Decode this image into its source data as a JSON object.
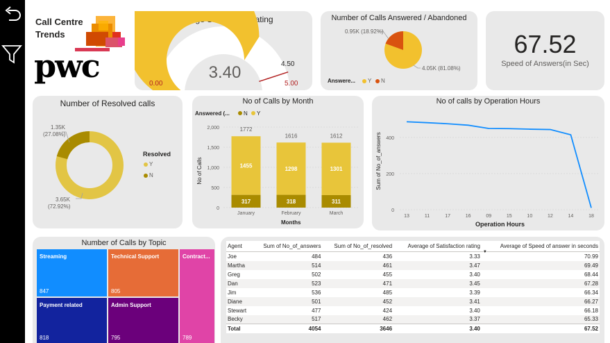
{
  "header": {
    "title_line1": "Call Centre",
    "title_line2": "Trends",
    "logo_text": "pwc"
  },
  "gauge": {
    "title": "Average Satisfaction rating",
    "value": "3.40",
    "min": "0.00",
    "max": "5.00",
    "target": "4.50",
    "numeric_value": 3.4,
    "numeric_max": 5.0,
    "numeric_target": 4.5,
    "fill_color": "#f2c12e",
    "track_color": "#ffffff",
    "target_color": "#b22222"
  },
  "answered_pie": {
    "title": "Number of Calls Answered / Abandoned",
    "legend_label": "Answere...",
    "legend_y": "Y",
    "legend_n": "N",
    "label_n": "0.95K (18.92%)",
    "label_y": "4.05K (81.08%)"
  },
  "kpi": {
    "value": "67.52",
    "label": "Speed of Answers(in Sec)"
  },
  "resolved_donut": {
    "title": "Number of Resolved calls",
    "legend_title": "Resolved",
    "legend_y": "Y",
    "legend_n": "N",
    "label_n_line1": "1.35K",
    "label_n_line2": "(27.08%)",
    "label_y_line1": "3.65K",
    "label_y_line2": "(72.92%)"
  },
  "month_chart": {
    "title": "No of Calls by Month",
    "legend_label": "Answered (...",
    "legend_n": "N",
    "legend_y": "Y",
    "ylabel": "No of Calls",
    "xlabel": "Months",
    "yticks": [
      "2,000",
      "1,500",
      "1,000",
      "500",
      "0"
    ]
  },
  "hours_chart": {
    "title": "No of calls by Operation Hours",
    "ylabel": "Sum of No_of_answers",
    "xlabel": "Operation Hours",
    "yticks": [
      "400",
      "200",
      "0"
    ]
  },
  "topic_tree": {
    "title": "Number of Calls by Topic",
    "cells": [
      {
        "label": "Streaming",
        "value": "847",
        "color": "#118dff"
      },
      {
        "label": "Technical Support",
        "value": "805",
        "color": "#e66c37"
      },
      {
        "label": "Contract...",
        "value": "789",
        "color": "#e044a7"
      },
      {
        "label": "Payment related",
        "value": "818",
        "color": "#12239e"
      },
      {
        "label": "Admin Support",
        "value": "795",
        "color": "#6b007b"
      }
    ]
  },
  "agent_table": {
    "headers": [
      "Agent",
      "Sum of No_of_answers",
      "Sum of No_of_resolved",
      "Average of Satisfaction rating",
      "Average of Speed of answer in seconds"
    ],
    "rows": [
      [
        "Joe",
        "484",
        "436",
        "3.33",
        "70.99"
      ],
      [
        "Martha",
        "514",
        "461",
        "3.47",
        "69.49"
      ],
      [
        "Greg",
        "502",
        "455",
        "3.40",
        "68.44"
      ],
      [
        "Dan",
        "523",
        "471",
        "3.45",
        "67.28"
      ],
      [
        "Jim",
        "536",
        "485",
        "3.39",
        "66.34"
      ],
      [
        "Diane",
        "501",
        "452",
        "3.41",
        "66.27"
      ],
      [
        "Stewart",
        "477",
        "424",
        "3.40",
        "66.18"
      ],
      [
        "Becky",
        "517",
        "462",
        "3.37",
        "65.33"
      ]
    ],
    "total": [
      "Total",
      "4054",
      "3646",
      "3.40",
      "67.52"
    ]
  },
  "chart_data": [
    {
      "type": "bar",
      "title": "No of Calls by Month",
      "xlabel": "Months",
      "ylabel": "No of Calls",
      "categories": [
        "January",
        "February",
        "March"
      ],
      "series": [
        {
          "name": "N",
          "values": [
            317,
            318,
            311
          ],
          "color": "#a98b00"
        },
        {
          "name": "Y",
          "values": [
            1455,
            1298,
            1301
          ],
          "color": "#e8c53a"
        }
      ],
      "totals": [
        1772,
        1616,
        1612
      ],
      "ylim": [
        0,
        2000
      ]
    },
    {
      "type": "line",
      "title": "No of calls by Operation Hours",
      "xlabel": "Operation Hours",
      "ylabel": "Sum of No_of_answers",
      "categories": [
        "13",
        "11",
        "17",
        "16",
        "09",
        "15",
        "10",
        "12",
        "14",
        "18"
      ],
      "values": [
        487,
        482,
        476,
        468,
        450,
        449,
        446,
        444,
        415,
        10
      ],
      "ylim": [
        0,
        500
      ],
      "color": "#118dff"
    },
    {
      "type": "pie",
      "title": "Number of Calls Answered / Abandoned",
      "categories": [
        "Y",
        "N"
      ],
      "values": [
        81.08,
        18.92
      ],
      "colors": [
        "#f2c12e",
        "#d9530f"
      ]
    },
    {
      "type": "pie",
      "title": "Number of Resolved calls",
      "categories": [
        "Y",
        "N"
      ],
      "values": [
        72.92,
        27.08
      ],
      "colors": [
        "#e2c545",
        "#a98b00"
      ]
    }
  ]
}
